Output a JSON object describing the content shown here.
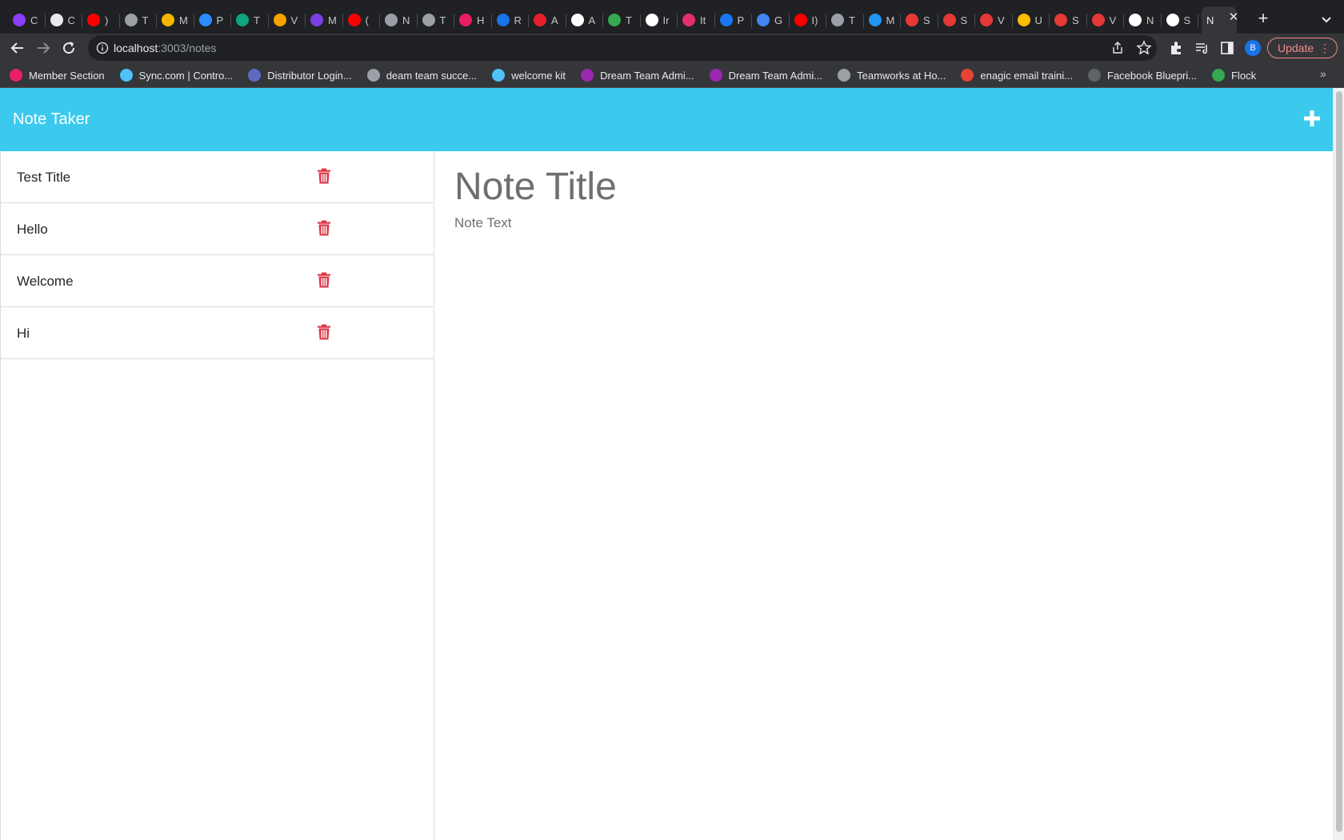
{
  "browser": {
    "tabs": [
      {
        "letter": "C",
        "color": "#8a3ffc"
      },
      {
        "letter": "C",
        "color": "#e8eaed"
      },
      {
        "letter": ")",
        "color": "#ff0000"
      },
      {
        "letter": "T",
        "color": "#9aa0a6"
      },
      {
        "letter": "M",
        "color": "#f2b705"
      },
      {
        "letter": "P",
        "color": "#2d8cff"
      },
      {
        "letter": "T",
        "color": "#10a37f"
      },
      {
        "letter": "V",
        "color": "#f4a300"
      },
      {
        "letter": "M",
        "color": "#7b3fe4"
      },
      {
        "letter": "(",
        "color": "#ff0000"
      },
      {
        "letter": "N",
        "color": "#9aa0a6"
      },
      {
        "letter": "T",
        "color": "#9aa0a6"
      },
      {
        "letter": "H",
        "color": "#e91e63"
      },
      {
        "letter": "R",
        "color": "#1a73e8"
      },
      {
        "letter": "A",
        "color": "#e5202d"
      },
      {
        "letter": "A",
        "color": "#ffffff"
      },
      {
        "letter": "T",
        "color": "#34a853"
      },
      {
        "letter": "Ir",
        "color": "#ffffff"
      },
      {
        "letter": "It",
        "color": "#e1306c"
      },
      {
        "letter": "P",
        "color": "#1877f2"
      },
      {
        "letter": "G",
        "color": "#4285f4"
      },
      {
        "letter": "I)",
        "color": "#ff0000"
      },
      {
        "letter": "T",
        "color": "#9aa0a6"
      },
      {
        "letter": "M",
        "color": "#2196f3"
      },
      {
        "letter": "S",
        "color": "#e53935"
      },
      {
        "letter": "S",
        "color": "#e53935"
      },
      {
        "letter": "V",
        "color": "#e53935"
      },
      {
        "letter": "U",
        "color": "#fbbc04"
      },
      {
        "letter": "S",
        "color": "#e53935"
      },
      {
        "letter": "V",
        "color": "#e53935"
      },
      {
        "letter": "N",
        "color": "#ffffff"
      },
      {
        "letter": "S",
        "color": "#ffffff"
      }
    ],
    "active_tab": {
      "letter": "N"
    },
    "url_host": "localhost",
    "url_path": ":3003/notes",
    "profile_initial": "B",
    "update_label": "Update",
    "bookmarks": [
      {
        "label": "Member Section",
        "color": "#e91e63"
      },
      {
        "label": "Sync.com | Contro...",
        "color": "#4fc3f7"
      },
      {
        "label": "Distributor Login...",
        "color": "#5c6bc0"
      },
      {
        "label": "deam team succe...",
        "color": "#9aa0a6"
      },
      {
        "label": "welcome kit",
        "color": "#4fc3f7"
      },
      {
        "label": "Dream Team Admi...",
        "color": "#9c27b0"
      },
      {
        "label": "Dream Team Admi...",
        "color": "#9c27b0"
      },
      {
        "label": "Teamworks at Ho...",
        "color": "#9aa0a6"
      },
      {
        "label": "enagic email traini...",
        "color": "#ea4335"
      },
      {
        "label": "Facebook Bluepri...",
        "color": "#5f6368"
      },
      {
        "label": "Flock",
        "color": "#34a853"
      }
    ],
    "bookmarks_more": "»"
  },
  "app": {
    "title": "Note Taker",
    "accent_color": "#3bcaee",
    "delete_color": "#dc3545",
    "notes": [
      {
        "title": "Test Title"
      },
      {
        "title": "Hello"
      },
      {
        "title": "Welcome"
      },
      {
        "title": "Hi"
      }
    ],
    "editor": {
      "title_placeholder": "Note Title",
      "text_placeholder": "Note Text"
    }
  }
}
